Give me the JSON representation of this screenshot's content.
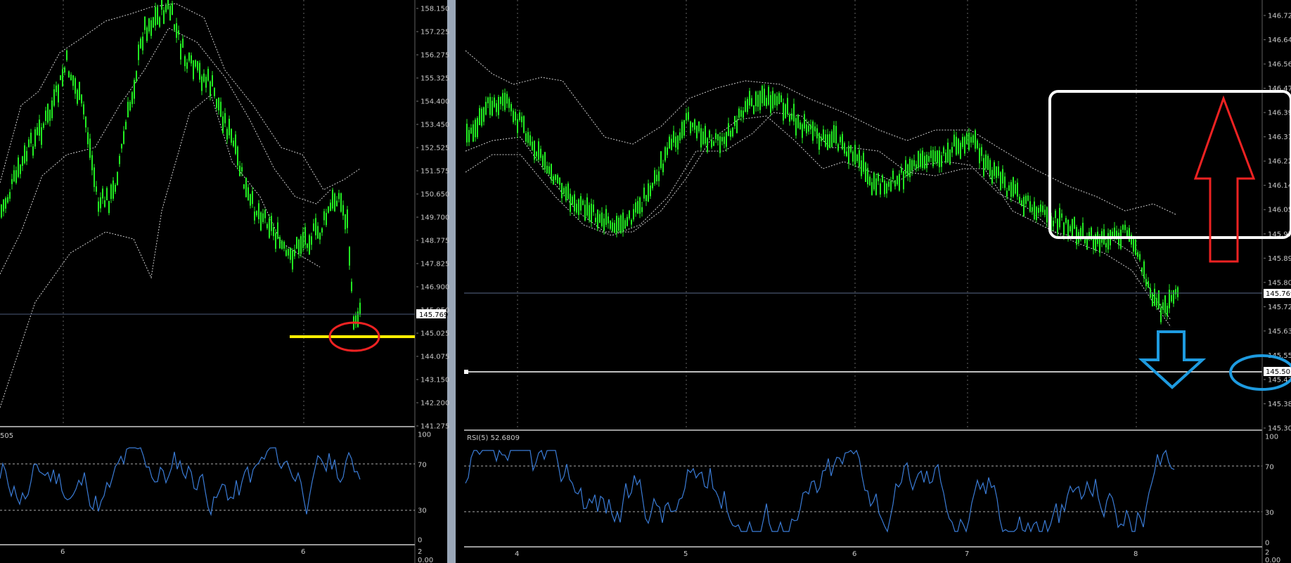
{
  "left_chart": {
    "price_axis": [
      "158.150",
      "157.225",
      "156.275",
      "155.325",
      "154.400",
      "153.450",
      "152.525",
      "151.575",
      "150.650",
      "149.700",
      "148.775",
      "147.825",
      "146.900",
      "145.950",
      "145.025",
      "144.075",
      "143.150",
      "142.200",
      "141.275"
    ],
    "current_price": "145.769",
    "time_labels": [
      "6",
      "6"
    ],
    "rsi_label": "505",
    "rsi_axis": [
      "100",
      "70",
      "30",
      "0"
    ],
    "bottom_axis": [
      "2",
      "0.00"
    ]
  },
  "right_chart": {
    "price_axis": [
      "146.725",
      "146.640",
      "146.560",
      "146.475",
      "146.395",
      "146.310",
      "146.225",
      "146.140",
      "146.055",
      "145.970",
      "145.890",
      "145.805",
      "145.720",
      "145.635",
      "145.555",
      "145.470",
      "145.385",
      "145.305"
    ],
    "current_price": "145.769",
    "marked_price": "145.501",
    "time_labels": [
      "4",
      "5",
      "6",
      "7",
      "8"
    ],
    "rsi_label": "RSI(5) 52.6809",
    "rsi_axis": [
      "100",
      "70",
      "30",
      "0"
    ],
    "bottom_axis": [
      "2",
      "0.00"
    ]
  },
  "colors": {
    "background": "#000000",
    "candles": "#22ee22",
    "bands": "#d0d0d0",
    "rsi_line": "#3a7bd5",
    "axis_text": "#c8c8c8",
    "annotation_yellow": "#ffee00",
    "annotation_red": "#ee2222",
    "annotation_white": "#ffffff",
    "annotation_blue": "#1e9be0"
  }
}
